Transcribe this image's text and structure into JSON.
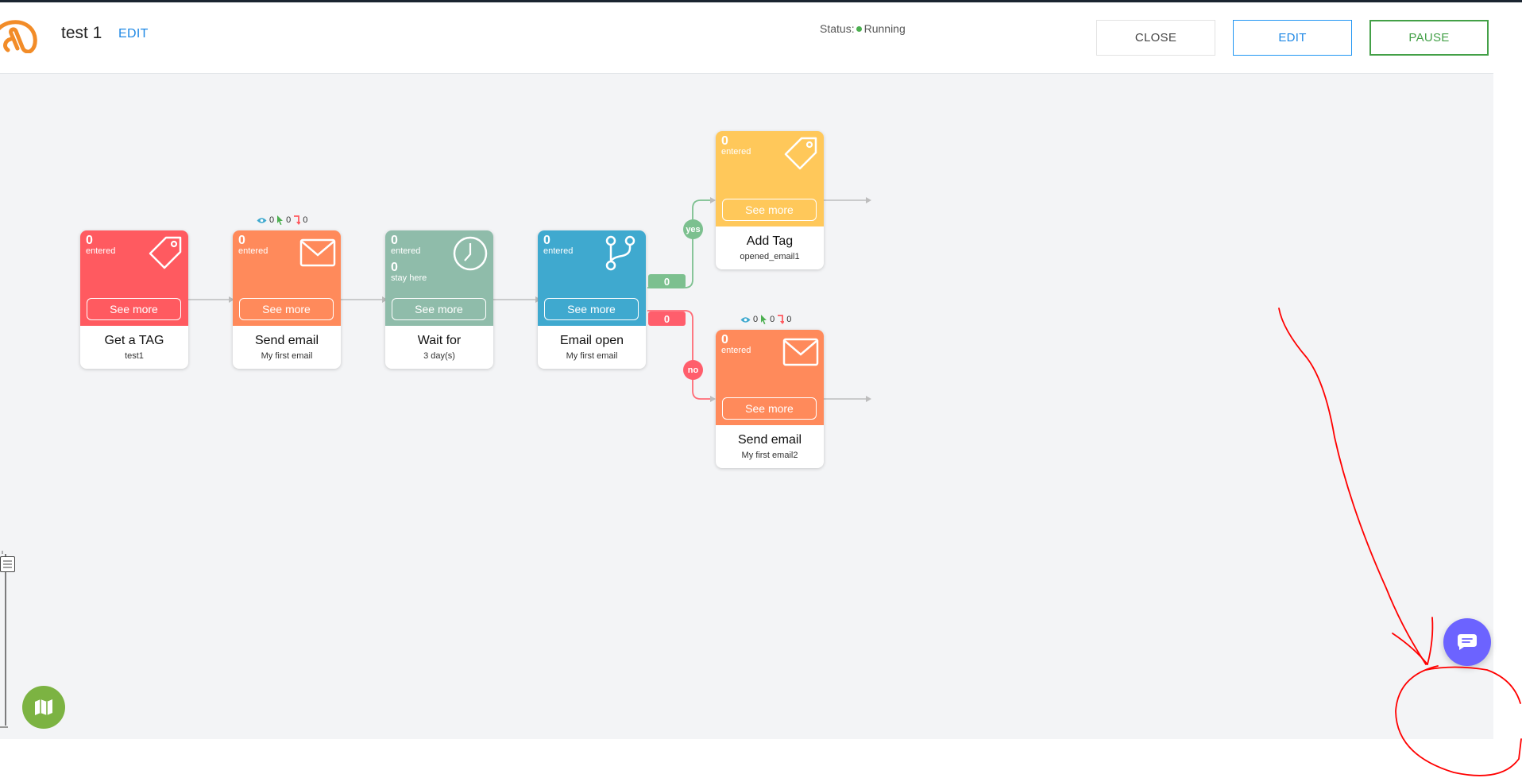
{
  "header": {
    "title": "test 1",
    "edit_link": "EDIT",
    "status_label": "Status:",
    "status_value": "Running",
    "close_button": "CLOSE",
    "edit_button": "EDIT",
    "pause_button": "PAUSE"
  },
  "nodes": [
    {
      "kind": "tag",
      "color": "#ff5a60",
      "entered_count": "0",
      "entered_label": "entered",
      "see_more": "See more",
      "title": "Get a TAG",
      "subtitle": "test1"
    },
    {
      "kind": "email",
      "color": "#ff8a5b",
      "entered_count": "0",
      "entered_label": "entered",
      "see_more": "See more",
      "title": "Send email",
      "subtitle": "My first email",
      "stats": {
        "opens": "0",
        "clicks": "0",
        "bounces": "0"
      }
    },
    {
      "kind": "wait",
      "color": "#8fbcaa",
      "entered_count": "0",
      "entered_label": "entered",
      "stay_count": "0",
      "stay_label": "stay here",
      "see_more": "See more",
      "title": "Wait for",
      "subtitle": "3 day(s)"
    },
    {
      "kind": "condition",
      "color": "#3fa9cf",
      "entered_count": "0",
      "entered_label": "entered",
      "see_more": "See more",
      "title": "Email open",
      "subtitle": "My first email"
    },
    {
      "kind": "tag",
      "color": "#ffc85a",
      "entered_count": "0",
      "entered_label": "entered",
      "see_more": "See more",
      "title": "Add Tag",
      "subtitle": "opened_email1"
    },
    {
      "kind": "email",
      "color": "#ff8a5b",
      "entered_count": "0",
      "entered_label": "entered",
      "see_more": "See more",
      "title": "Send email",
      "subtitle": "My first email2",
      "stats": {
        "opens": "0",
        "clicks": "0",
        "bounces": "0"
      }
    }
  ],
  "branches": {
    "yes_count": "0",
    "no_count": "0",
    "yes_label": "yes",
    "no_label": "no"
  },
  "colors": {
    "accent_blue": "#1e88e5",
    "pause_green": "#43a047",
    "status_green": "#4caf50",
    "yes_green": "#7cc08f",
    "no_red": "#ff5e6c",
    "map_button": "#7cb342",
    "chat_button": "#6c63ff",
    "annotation_red": "#ff0000"
  },
  "icons": {
    "logo": "brand-logo-icon",
    "tag": "tag-icon",
    "email": "envelope-icon",
    "wait": "clock-icon",
    "condition": "branch-icon",
    "opens": "eye-icon",
    "clicks": "cursor-icon",
    "bounces": "bounce-icon",
    "map": "map-icon",
    "chat": "chat-icon",
    "zoom": "zoom-slider-handle"
  }
}
